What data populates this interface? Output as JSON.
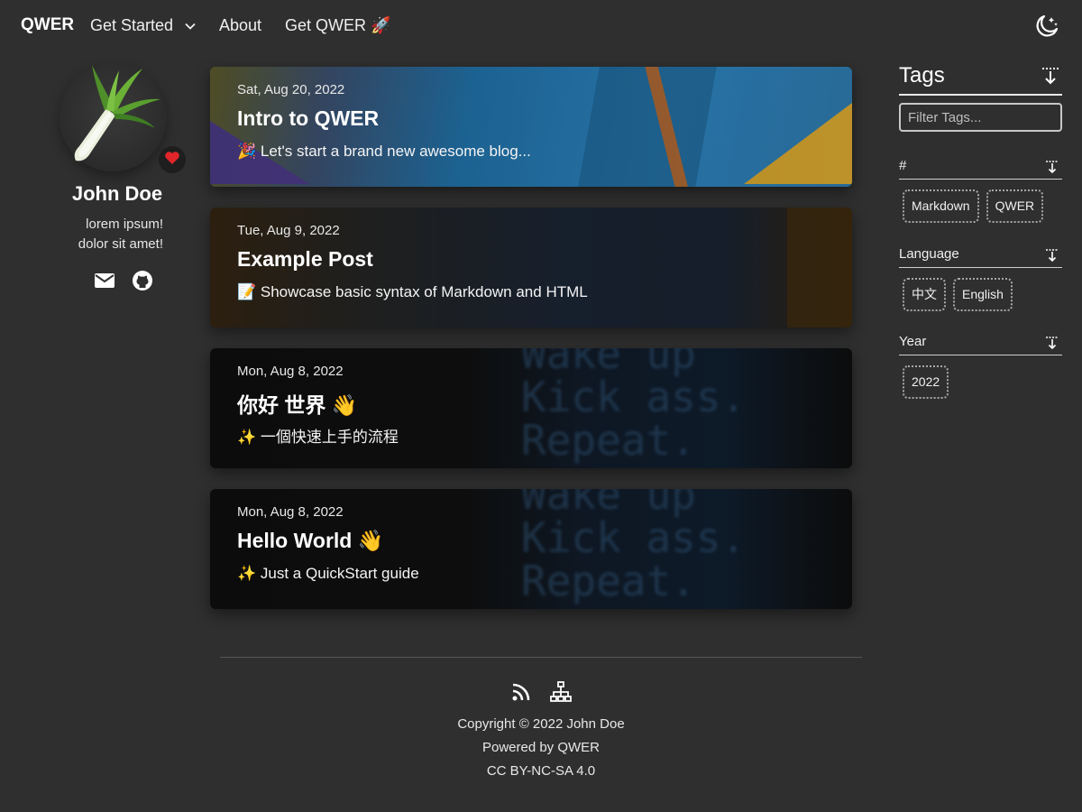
{
  "nav": {
    "brand": "QWER",
    "links": [
      {
        "label": "Get Started",
        "has_dropdown": true,
        "icon": "chevron-down-icon"
      },
      {
        "label": "About"
      },
      {
        "label": "Get QWER 🚀"
      }
    ],
    "theme_toggle_icon": "moon-stars-icon"
  },
  "profile": {
    "avatar_icon": "leek-avatar",
    "badge_icon": "heart-icon",
    "name": "John Doe",
    "bio_lines": [
      "lorem ipsum!",
      "dolor sit amet!"
    ],
    "social_icons": [
      "email-icon",
      "github-icon"
    ]
  },
  "posts": [
    {
      "date": "Sat, Aug 20, 2022",
      "title": "Intro to QWER",
      "summary": "🎉 Let's start a brand new awesome blog..."
    },
    {
      "date": "Tue, Aug 9, 2022",
      "title": "Example Post",
      "summary": "📝 Showcase basic syntax of Markdown and HTML"
    },
    {
      "date": "Mon, Aug 8, 2022",
      "title": "你好 世界 👋",
      "summary": "✨ 一個快速上手的流程"
    },
    {
      "date": "Mon, Aug 8, 2022",
      "title": "Hello World 👋",
      "summary": "✨ Just a QuickStart guide"
    }
  ],
  "tags": {
    "title": "Tags",
    "filter_placeholder": "Filter Tags...",
    "groups": [
      {
        "name": "#",
        "chips": [
          "Markdown",
          "QWER"
        ]
      },
      {
        "name": "Language",
        "chips": [
          "中文",
          "English"
        ]
      },
      {
        "name": "Year",
        "chips": [
          "2022"
        ]
      }
    ]
  },
  "footer": {
    "icons": [
      "rss-icon",
      "sitemap-icon"
    ],
    "copyright": "Copyright © 2022 John Doe",
    "powered": "Powered by QWER",
    "license": "CC BY-NC-SA 4.0"
  },
  "colors": {
    "background": "#2f2f2f",
    "text": "#f2f2f2",
    "heart": "#e0252b"
  }
}
